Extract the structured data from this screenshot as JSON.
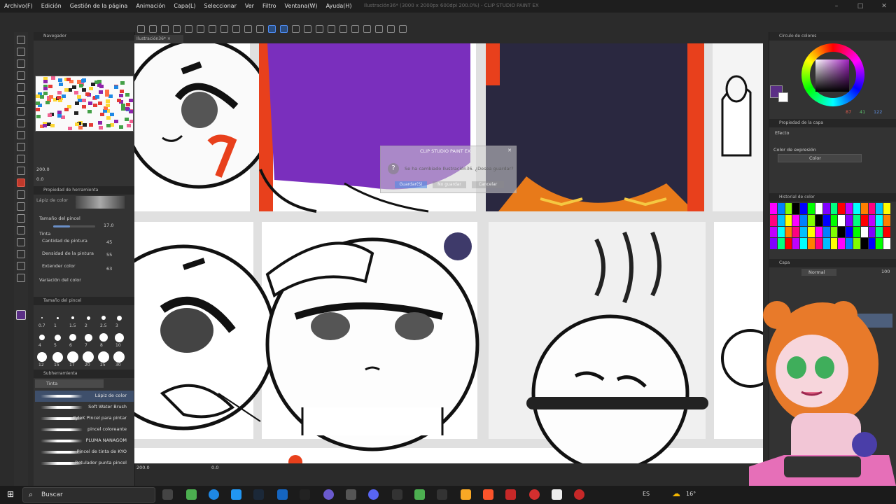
{
  "app": {
    "title": "Ilustración36* (3000 x 2000px 600dpi 200.0%) - CLIP STUDIO PAINT EX",
    "tab_label": "Ilustración36* ×"
  },
  "menu": [
    "Archivo(F)",
    "Edición",
    "Gestión de la página",
    "Animación",
    "Capa(L)",
    "Seleccionar",
    "Ver",
    "Filtro",
    "Ventana(W)",
    "Ayuda(H)"
  ],
  "panels": {
    "navigator": "Navegador",
    "zoom_value": "200.0",
    "rotation_value": "0.0",
    "tool_property": "Propiedad de herramienta",
    "tool_name": "Lápiz de color",
    "brush_size_label": "Tamaño del pincel",
    "brush_size_value": "17.0",
    "ink_label": "Tinta",
    "paint_amount_label": "Cantidad de pintura",
    "paint_amount_value": "45",
    "paint_density_label": "Densidad de la pintura",
    "paint_density_value": "55",
    "blend_label": "Extender color",
    "blend_value": "63",
    "brush_variation": "Variación del color",
    "brush_size_panel": "Tamaño del pincel",
    "subtool_panel": "Subherramienta",
    "subtool_group": "Tinta",
    "color_circle": "Círculo de colores",
    "layer_property": "Propiedad de la capa",
    "effect_label": "Efecto",
    "expression_label": "Color de expresión",
    "expression_value": "Color",
    "color_history": "Historial de color",
    "layer_panel": "Capa",
    "blend_mode": "Normal",
    "opacity": "100",
    "hsv": [
      "87",
      "41",
      "122"
    ]
  },
  "brush_sizes": [
    "0.7",
    "1",
    "1.5",
    "2",
    "2.5",
    "3",
    "4",
    "5",
    "6",
    "7",
    "8",
    "10",
    "12",
    "15",
    "17",
    "20",
    "25",
    "30"
  ],
  "brushes": [
    "Lápiz de color",
    "Soft Water Brush",
    "KyleK Pincel para pintar",
    "pincel coloreante",
    "PLUMA NANAGOM",
    "Pincel de tinta de KYO",
    "Rotulador punta pincel"
  ],
  "dialog": {
    "title": "CLIP STUDIO PAINT EX",
    "message": "Se ha cambiado Ilustración36. ¿Desea guardar?",
    "save": "Guardar(S)",
    "dont_save": "No guardar",
    "cancel": "Cancelar"
  },
  "status": {
    "zoom": "200.0",
    "angle": "0.0"
  },
  "taskbar": {
    "search_placeholder": "Buscar",
    "lang": "ES",
    "temp": "16°"
  },
  "colors": {
    "main_color": "#5b2f86",
    "accent": "#4f8ef7"
  }
}
